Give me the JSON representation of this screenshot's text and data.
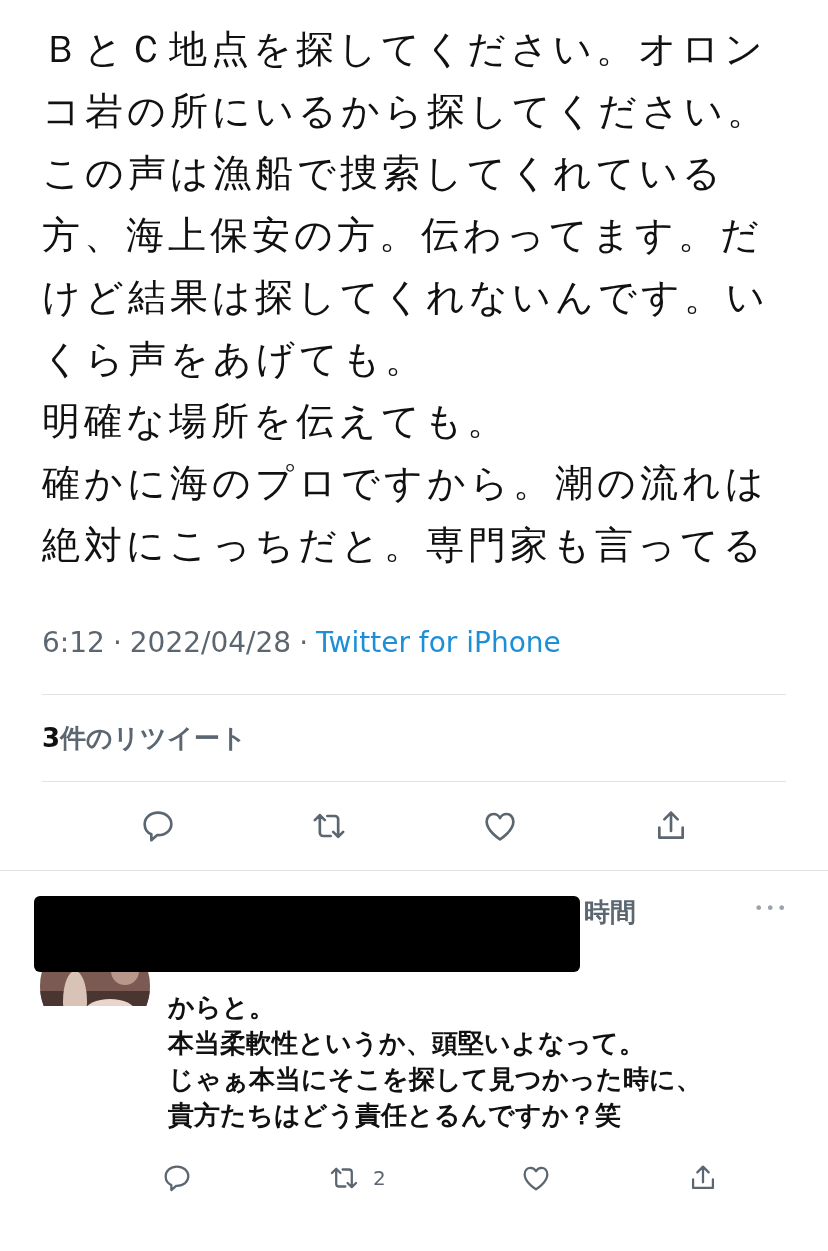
{
  "tweet": {
    "text_lines": [
      "ＢとＣ地点を探してください。オロン",
      "コ岩の所にいるから探してください。",
      "この声は漁船で捜索してくれている",
      "方、海上保安の方。伝わってます。だ",
      "けど結果は探してくれないんです。い",
      "くら声をあげても。",
      "明確な場所を伝えても。",
      "確かに海のプロですから。潮の流れは",
      "絶対にこっちだと。専門家も言ってる"
    ],
    "time": "6:12",
    "separators": [
      "·",
      "·"
    ],
    "date": "2022/04/28",
    "source": "Twitter for iPhone",
    "retweet_count": "3",
    "retweet_label": "件のリツイート"
  },
  "reply": {
    "time_fragment": "時間",
    "more": "•••",
    "text_lines": [
      "からと。",
      "本当柔軟性というか、頭堅いよなって。",
      "じゃぁ本当にそこを探して見つかった時に、",
      "貴方たちはどう責任とるんですか？笑"
    ],
    "retweets": "2"
  }
}
